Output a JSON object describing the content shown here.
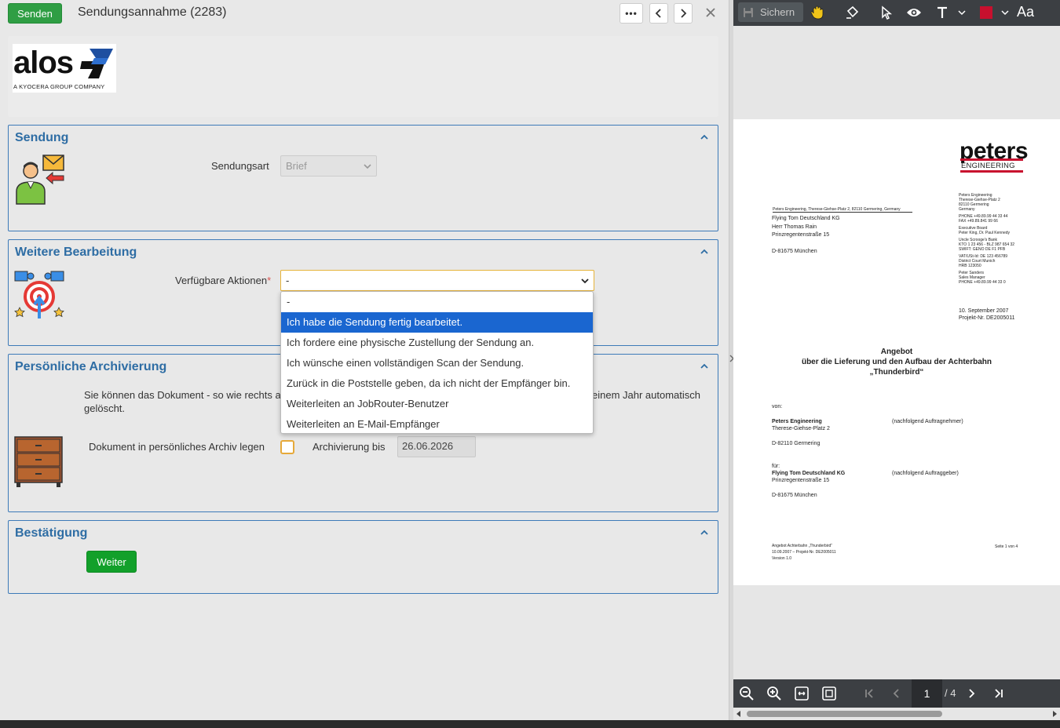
{
  "header": {
    "send_label": "Senden",
    "title": "Sendungsannahme (2283)",
    "more_label": "•••",
    "prev_label": "‹",
    "next_label": "›",
    "close_label": "✕"
  },
  "logo": {
    "text": "alos",
    "subtitle": "A KYOCERA GROUP COMPANY"
  },
  "sections": {
    "sendung": {
      "title": "Sendung",
      "field_label": "Sendungsart",
      "field_value": "Brief"
    },
    "weitere": {
      "title": "Weitere Bearbeitung",
      "field_label": "Verfügbare Aktionen",
      "required_mark": "*",
      "field_value": "-",
      "options": [
        "-",
        "Ich habe die Sendung fertig bearbeitet.",
        "Ich fordere eine physische Zustellung der Sendung an.",
        "Ich wünsche einen vollständigen Scan der Sendung.",
        "Zurück in die Poststelle geben, da ich nicht der Empfänger bin.",
        "Weiterleiten an JobRouter-Benutzer",
        "Weiterleiten an E-Mail-Empfänger"
      ],
      "selected_index": 1
    },
    "archiv": {
      "title": "Persönliche Archivierung",
      "info_start": "Sie können das Dokument - so wie rechts a",
      "info_end": "einem Jahr automatisch",
      "info_line2": "gelöscht.",
      "checkbox_label": "Dokument in persönliches Archiv legen",
      "checkbox_checked": false,
      "date_label": "Archivierung bis",
      "date_value": "26.06.2026"
    },
    "bestaetigung": {
      "title": "Bestätigung",
      "button_label": "Weiter"
    }
  },
  "viewer": {
    "save_label": "Sichern",
    "font_label": "Aa",
    "accent_color": "#c8102e",
    "page_current": "1",
    "page_total": "/ 4",
    "document": {
      "brand_top": "peters",
      "brand_bottom": "ENGINEERING",
      "sender_line": "Peters Engineering, Therese-Giehse-Platz 2, 82110 Germering, Germany",
      "recipient": [
        "Flying Tom Deutschland KG",
        "Herr Thomas Rain",
        "Prinzregentenstraße 15",
        "",
        "D-81675 München"
      ],
      "company_info": [
        "Peters Engineering",
        "Therese-Giehse-Platz 2",
        "82110 Germering",
        "Germany",
        "",
        "PHONE     +49.89.99 44 33 44",
        "FAX         +49.89.841 99 66",
        "",
        "Executive Board",
        "Peter King, Dr. Paul Kennedy",
        "",
        "Uncle Scrooge's Bank",
        "KTO 1 23 456 - BLZ 987 654 32",
        "SWIFT: GENO DE F1 PFB",
        "",
        "VAT/USt-Id: DE 123 456789",
        "District Court Munich",
        "HRB 123050",
        "",
        "Peter Sanders",
        "Sales Manager",
        "PHONE +49.89.99 44 33 0"
      ],
      "date": "10. September 2007",
      "project": "Projekt-Nr. DE2005011",
      "heading1": "Angebot",
      "heading2": "über die Lieferung und den Aufbau der Achterbahn",
      "heading3": "„Thunderbird“",
      "von_label": "von:",
      "von_name": "Peters Engineering",
      "von_street": "Therese-Giehse-Platz 2",
      "von_city": "D-82110 Germering",
      "von_note": "(nachfolgend Auftragnehmer)",
      "fuer_label": "für:",
      "fuer_name": "Flying Tom Deutschland KG",
      "fuer_street": "Prinzregentenstraße 15",
      "fuer_city": "D-81675 München",
      "fuer_note": "(nachfolgend Auftraggeber)",
      "footer_lines": [
        "Angebot Achterbahn „Thunderbird“",
        "10.09.2007 – Projekt-Nr. DE2005011",
        "Version 1.0"
      ],
      "footer_page": "Seite 1 von 4"
    }
  }
}
